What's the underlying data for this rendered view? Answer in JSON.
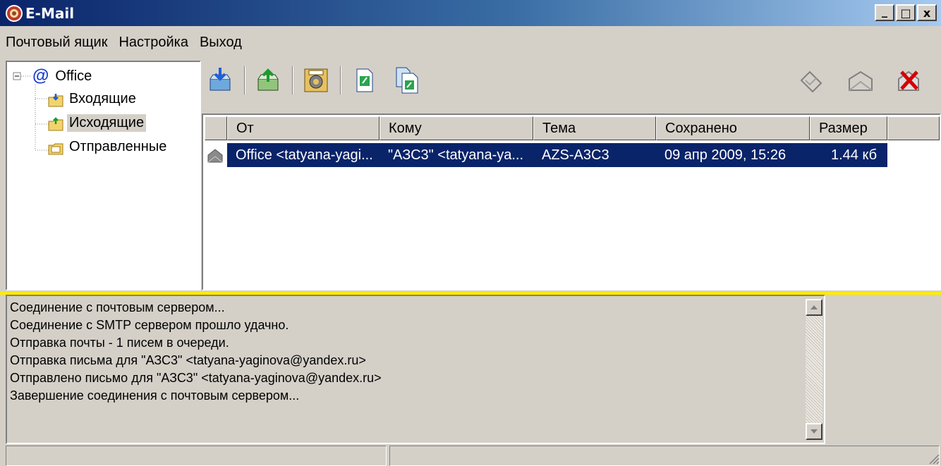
{
  "window": {
    "title": "E-Mail",
    "buttons": [
      "_",
      "□",
      "x"
    ]
  },
  "menu": {
    "items": [
      "Почтовый ящик",
      "Настройка",
      "Выход"
    ]
  },
  "tree": {
    "account": "Office",
    "folders": [
      {
        "label": "Входящие",
        "icon": "inbox-folder-icon"
      },
      {
        "label": "Исходящие",
        "icon": "outbox-folder-icon",
        "selected": true
      },
      {
        "label": "Отправленные",
        "icon": "sent-folder-icon"
      }
    ]
  },
  "toolbar": {
    "left": [
      "receive-mail-icon",
      "send-mail-icon",
      "settings-icon",
      "new-message-icon",
      "copy-message-icon"
    ],
    "right": [
      "reply-icon",
      "forward-icon",
      "delete-icon"
    ]
  },
  "list": {
    "columns": [
      "От",
      "Кому",
      "Тема",
      "Сохранено",
      "Размер"
    ],
    "rows": [
      {
        "from": "Office <tatyana-yagi...",
        "to": "\"АЗС3\" <tatyana-ya...",
        "subject": "AZS-A3C3",
        "saved": "09 апр 2009, 15:26",
        "size": "1.44 кб"
      }
    ]
  },
  "log": {
    "lines": [
      "Соединение с почтовым сервером...",
      "Соединение с SMTP сервером прошло удачно.",
      "Отправка почты - 1 писем в очереди.",
      "Отправка письма для \"АЗС3\" <tatyana-yaginova@yandex.ru>",
      "Отправлено письмо для \"АЗС3\" <tatyana-yaginova@yandex.ru>",
      "Завершение соединения с почтовым сервером..."
    ]
  },
  "colors": {
    "title_start": "#0a246a",
    "title_end": "#a6caf0",
    "selection": "#0a246a",
    "divider": "#ffeb00",
    "chrome": "#d4d0c8"
  }
}
